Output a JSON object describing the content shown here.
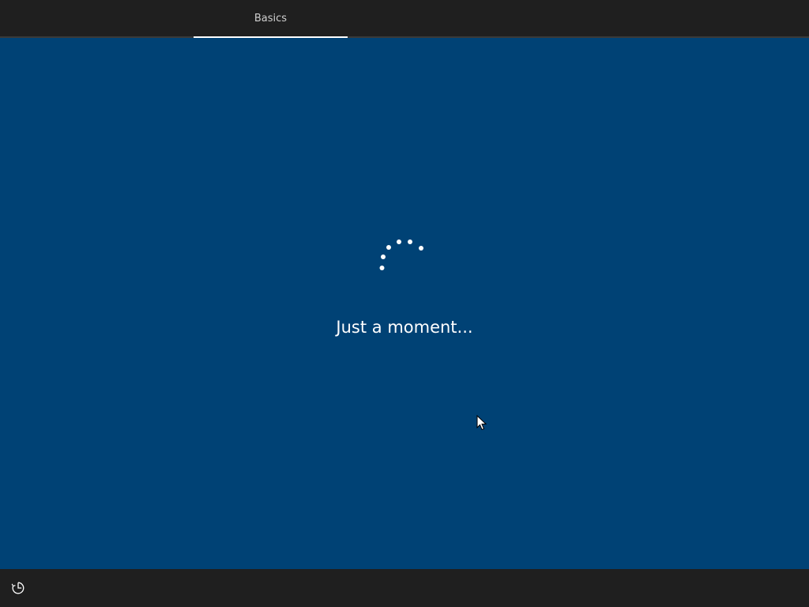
{
  "header": {
    "tabs": [
      {
        "label": "Basics",
        "active": true
      }
    ]
  },
  "main": {
    "status_text": "Just a moment..."
  },
  "footer": {
    "accessibility_icon": "ease-of-access-icon"
  },
  "colors": {
    "background": "#004275",
    "bars": "#1f1f1f",
    "text": "#ffffff"
  }
}
